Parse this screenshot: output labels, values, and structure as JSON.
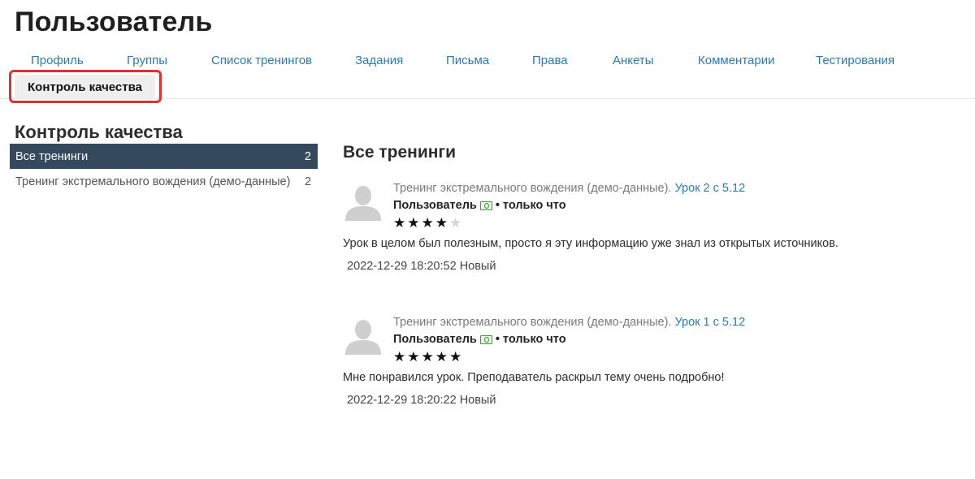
{
  "page_title": "Пользователь",
  "tabs": [
    {
      "label": "Профиль"
    },
    {
      "label": "Группы"
    },
    {
      "label": "Список тренингов"
    },
    {
      "label": "Задания"
    },
    {
      "label": "Письма"
    },
    {
      "label": "Права"
    },
    {
      "label": "Анкеты"
    },
    {
      "label": "Комментарии"
    },
    {
      "label": "Тестирования"
    }
  ],
  "active_tab": {
    "label": "Контроль качества"
  },
  "sidebar": {
    "title": "Контроль качества",
    "items": [
      {
        "label": "Все тренинги",
        "count": "2",
        "active": true
      },
      {
        "label": "Тренинг экстремального вождения (демо-данные)",
        "count": "2",
        "active": false
      }
    ]
  },
  "content": {
    "title": "Все тренинги",
    "comments": [
      {
        "training": "Тренинг экстремального вождения (демо-данные).",
        "lesson": "Урок 2 с 5.12",
        "author": "Пользователь",
        "time_sep": "•",
        "time": "только что",
        "rating": 4,
        "rating_max": 5,
        "text": "Урок в целом был полезным, просто я эту информацию уже знал из открытых источников.",
        "date": "2022-12-29 18:20:52",
        "status": "Новый"
      },
      {
        "training": "Тренинг экстремального вождения (демо-данные).",
        "lesson": "Урок 1 с 5.12",
        "author": "Пользователь",
        "time_sep": "•",
        "time": "только что",
        "rating": 5,
        "rating_max": 5,
        "text": "Мне понравился урок. Преподаватель раскрыл тему очень подробно!",
        "date": "2022-12-29 18:20:22",
        "status": "Новый"
      }
    ]
  },
  "colors": {
    "link": "#2a7ab8",
    "sidebar_active_bg": "#34495e",
    "highlight_border": "#e0302a"
  },
  "icons": {
    "avatar": "user-silhouette-icon",
    "money": "money-icon",
    "star": "star-icon"
  }
}
